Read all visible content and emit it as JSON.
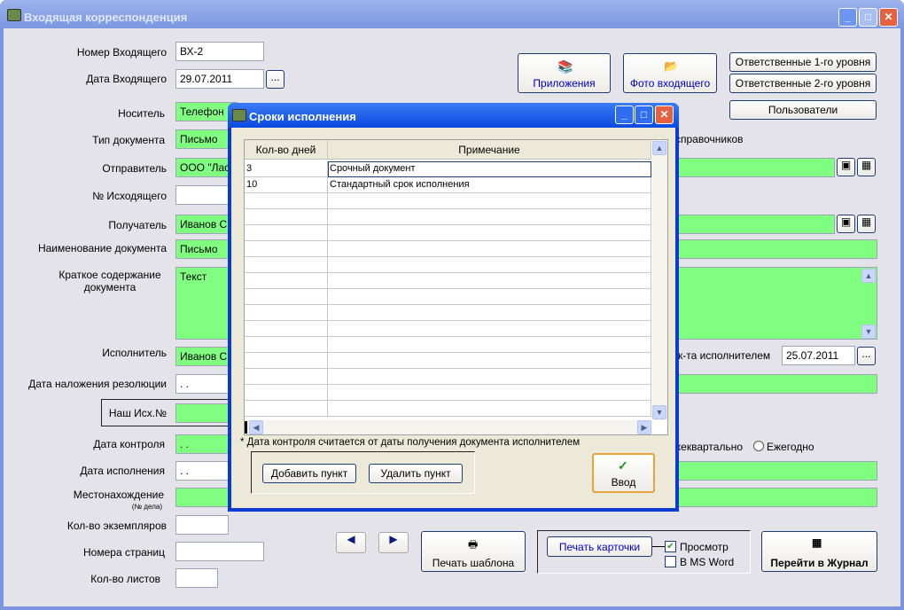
{
  "main": {
    "title": "Входящая корреспонденция",
    "fields": {
      "incoming_number_label": "Номер Входящего",
      "incoming_number": "ВХ-2",
      "incoming_date_label": "Дата Входящего",
      "incoming_date": "29.07.2011",
      "carrier_label": "Носитель",
      "carrier": "Телефон",
      "doc_type_label": "Тип документа",
      "doc_type": "Письмо",
      "sender_label": "Отправитель",
      "sender": "ООО \"Лас",
      "outgoing_number_label": "№ Исходящего",
      "recipient_label": "Получатель",
      "recipient": "Иванов С",
      "doc_name_label": "Наименование документа",
      "doc_name": "Письмо",
      "summary_label": "Краткое содержание документа",
      "summary": "Текст",
      "executor_label": "Исполнитель",
      "executor": "Иванов С",
      "resolution_date_label": "Дата наложения резолюции",
      "resolution_date": " . .",
      "our_out_label": "Наш Исх.№",
      "control_date_label": "Дата контроля",
      "control_date": " . .",
      "execution_date_label": "Дата исполнения",
      "execution_date": " . .",
      "location_label": "Местонахождение",
      "location_sub": "(№ дела)",
      "copies_label": "Кол-во экземпляров",
      "pages_numbers_label": "Номера страниц",
      "sheets_label": "Кол-во листов",
      "exec_received_label": "к-та исполнителем",
      "exec_received_date": "25.07.2011",
      "directories_text": "справочников",
      "quarterly_label": "ежеквартально",
      "yearly_label": "Ежегодно"
    },
    "buttons": {
      "ellipsis": "...",
      "attachments": "Приложения",
      "photo": "Фото входящего",
      "resp1": "Ответственные 1-го уровня",
      "resp2": "Ответственные 2-го уровня",
      "users": "Пользователи",
      "print_template": "Печать шаблона",
      "print_card": "Печать карточки",
      "preview": "Просмотр",
      "ms_word": "В MS Word",
      "go_journal": "Перейти в Журнал"
    },
    "checkboxes": {
      "preview": true,
      "ms_word": false
    }
  },
  "dialog": {
    "title": "Сроки исполнения",
    "columns": [
      "Кол-во дней",
      "Примечание"
    ],
    "rows": [
      {
        "days": "3",
        "note": "Срочный документ"
      },
      {
        "days": "10",
        "note": "Стандартный срок исполнения"
      }
    ],
    "footnote": "* Дата контроля считается от даты получения документа исполнителем",
    "add": "Добавить пункт",
    "delete": "Удалить пункт",
    "enter": "Ввод"
  }
}
